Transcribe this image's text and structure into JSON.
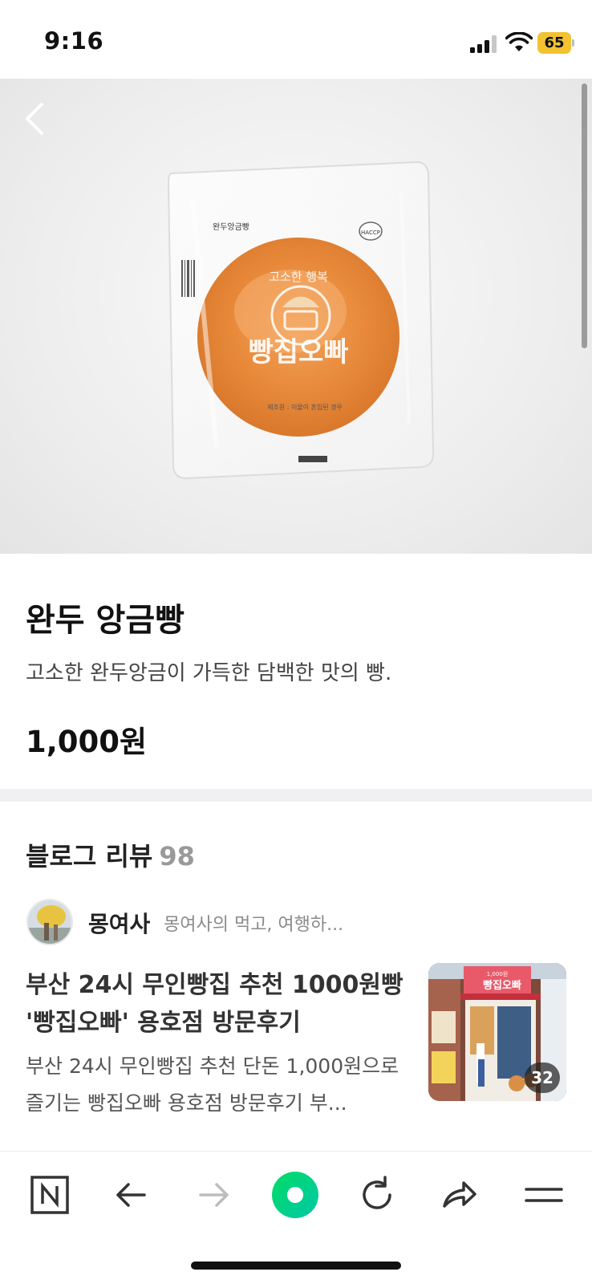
{
  "status_bar": {
    "time": "9:16",
    "battery_level": "65",
    "battery_color": "#f2c230",
    "icons": [
      "signal-icon",
      "wifi-icon",
      "battery-icon"
    ]
  },
  "hero": {
    "image": "photo of a round bun in clear plastic wrap",
    "package_label_top": "완두앙금빵",
    "package_brand": "빵집오빠",
    "package_slogan": "고소한 행복",
    "package_fineprint": "제조원 : 이물이 혼입된 경우",
    "package_badge": "HACCP"
  },
  "product": {
    "title": "완두 앙금빵",
    "description": "고소한 완두앙금이 가득한 담백한 맛의 빵.",
    "price": "1,000원"
  },
  "reviews": {
    "heading": "블로그 리뷰",
    "count": "98",
    "post": {
      "author": "몽여사",
      "blog_name": "몽여사의 먹고, 여행하...",
      "title": "부산 24시 무인빵집 추천 1000원빵 '빵집오빠' 용호점 방문후기",
      "excerpt": "부산 24시 무인빵집 추천 단돈 1,000원으로 즐기는 빵집오빠 용호점 방문후기 부...",
      "image_count": "32",
      "thumb_sign": "빵집오빠",
      "thumb_price": "1,000원"
    }
  },
  "toolbar": {
    "items": [
      "naver-home-icon",
      "back-arrow-icon",
      "forward-arrow-icon",
      "green-dot-icon",
      "refresh-icon",
      "share-icon",
      "menu-icon"
    ],
    "accent_color": "#03c75a"
  }
}
